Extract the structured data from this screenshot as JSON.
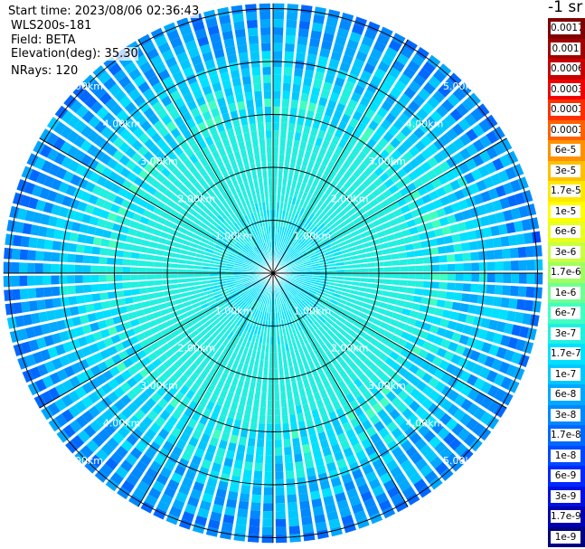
{
  "header": {
    "start_time": "Start time: 2023/08/06 02:36:43",
    "instrument": "WLS200s-181",
    "field": "Field: BETA",
    "elevation": "Elevation(deg): 35.30",
    "nrays": "NRays: 120"
  },
  "colorbar": {
    "unit": "-1 sr",
    "labels": [
      "0.0017",
      "0.001",
      "0.0006",
      "0.0003",
      "0.00017",
      "0.0001",
      "6e-5",
      "3e-5",
      "1.7e-5",
      "1e-5",
      "6e-6",
      "3e-6",
      "1.7e-6",
      "1e-6",
      "6e-7",
      "3e-7",
      "1.7e-7",
      "1e-7",
      "6e-8",
      "3e-8",
      "1.7e-8",
      "1e-8",
      "6e-9",
      "3e-9",
      "1.7e-9",
      "1e-9"
    ],
    "colors": [
      "#7f0000",
      "#a00000",
      "#c80000",
      "#f00000",
      "#ff3000",
      "#ff6000",
      "#ff9000",
      "#ffc000",
      "#ffe800",
      "#ffff00",
      "#e8ff20",
      "#c8ff40",
      "#a0ff60",
      "#70ff90",
      "#40ffc0",
      "#20f0e0",
      "#00e0ff",
      "#00c8ff",
      "#00a8ff",
      "#0088ff",
      "#0068ff",
      "#0048ff",
      "#0028ff",
      "#0010e0",
      "#0000b0",
      "#000080"
    ]
  },
  "chart_data": {
    "type": "heatmap",
    "projection": "polar PPI",
    "range_rings_km": [
      1,
      2,
      3,
      4,
      5
    ],
    "range_ring_labels": [
      "1.00km",
      "2.00km",
      "3.00km",
      "4.00km",
      "5.00km"
    ],
    "azimuth_spokes_deg": [
      0,
      30,
      60,
      90,
      120,
      150,
      180,
      210,
      240,
      270,
      300,
      330
    ],
    "field": "BETA",
    "elevation_deg": 35.3,
    "n_rays": 120,
    "max_range_km": 5.1,
    "value_scale": "log",
    "value_range": [
      1e-09,
      0.0017
    ],
    "profile": [
      {
        "range_km": 0.5,
        "value_class": "1.7e-7"
      },
      {
        "range_km": 1.5,
        "value_class": "3e-7"
      },
      {
        "range_km": 2.5,
        "value_class": "3e-7"
      },
      {
        "range_km": 3.5,
        "value_class": "1.7e-7"
      },
      {
        "range_km": 4.5,
        "value_class": "6e-8"
      },
      {
        "range_km": 5.0,
        "value_class": "3e-8"
      }
    ]
  }
}
